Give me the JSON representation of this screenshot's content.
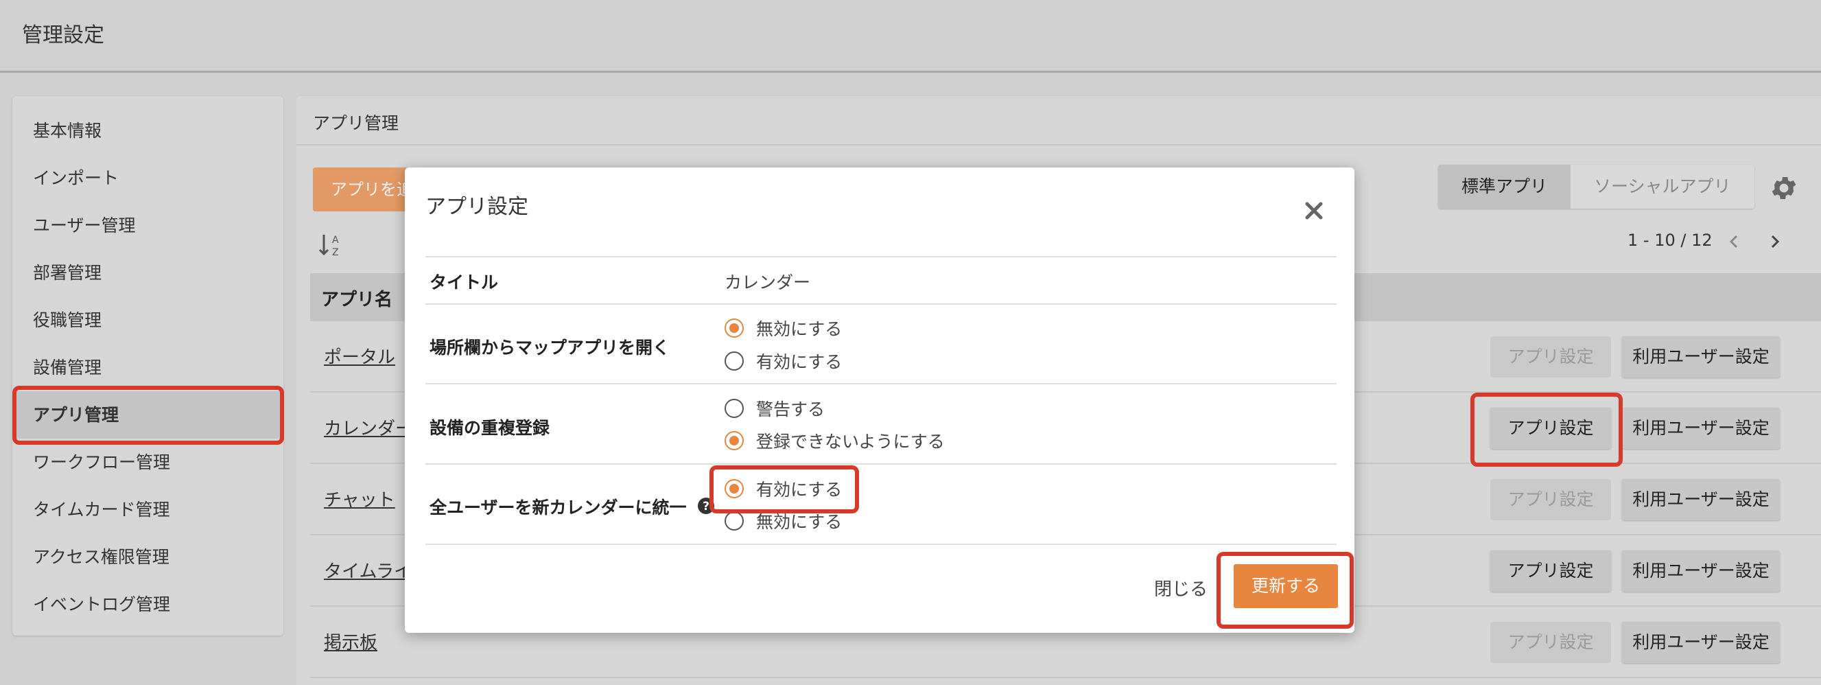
{
  "header": {
    "title": "管理設定"
  },
  "sidebar": {
    "items": [
      {
        "label": "基本情報"
      },
      {
        "label": "インポート"
      },
      {
        "label": "ユーザー管理"
      },
      {
        "label": "部署管理"
      },
      {
        "label": "役職管理"
      },
      {
        "label": "設備管理"
      },
      {
        "label": "アプリ管理",
        "active": true
      },
      {
        "label": "ワークフロー管理"
      },
      {
        "label": "タイムカード管理"
      },
      {
        "label": "アクセス権限管理"
      },
      {
        "label": "イベントログ管理"
      }
    ]
  },
  "main": {
    "title": "アプリ管理",
    "add_button": "アプリを追加",
    "tabs": [
      {
        "label": "標準アプリ",
        "active": true
      },
      {
        "label": "ソーシャルアプリ",
        "active": false
      }
    ],
    "pagination": "1 - 10 / 12",
    "table_header": "アプリ名",
    "rows": [
      {
        "name": "ポータル",
        "app_btn": "アプリ設定",
        "app_enabled": false,
        "user_btn": "利用ユーザー設定"
      },
      {
        "name": "カレンダー",
        "app_btn": "アプリ設定",
        "app_enabled": true,
        "user_btn": "利用ユーザー設定"
      },
      {
        "name": "チャット",
        "app_btn": "アプリ設定",
        "app_enabled": false,
        "user_btn": "利用ユーザー設定"
      },
      {
        "name": "タイムライン",
        "app_btn": "アプリ設定",
        "app_enabled": true,
        "user_btn": "利用ユーザー設定"
      },
      {
        "name": "掲示板",
        "app_btn": "アプリ設定",
        "app_enabled": false,
        "user_btn": "利用ユーザー設定"
      }
    ]
  },
  "modal": {
    "title": "アプリ設定",
    "rows": {
      "title_label": "タイトル",
      "title_value": "カレンダー",
      "map_label": "場所欄からマップアプリを開く",
      "map_opt1": "無効にする",
      "map_opt2": "有効にする",
      "dup_label": "設備の重複登録",
      "dup_opt1": "警告する",
      "dup_opt2": "登録できないようにする",
      "unify_label": "全ユーザーを新カレンダーに統一",
      "unify_opt1": "有効にする",
      "unify_opt2": "無効にする"
    },
    "selected": {
      "map": "無効にする",
      "dup": "登録できないようにする",
      "unify": "有効にする"
    },
    "close_label": "閉じる",
    "update_label": "更新する"
  },
  "colors": {
    "accent": "#e8853f",
    "highlight": "#d63a2a"
  },
  "icons": [
    "sort-az-icon",
    "gear-icon",
    "chevron-left-icon",
    "chevron-right-icon",
    "close-icon",
    "help-icon"
  ]
}
